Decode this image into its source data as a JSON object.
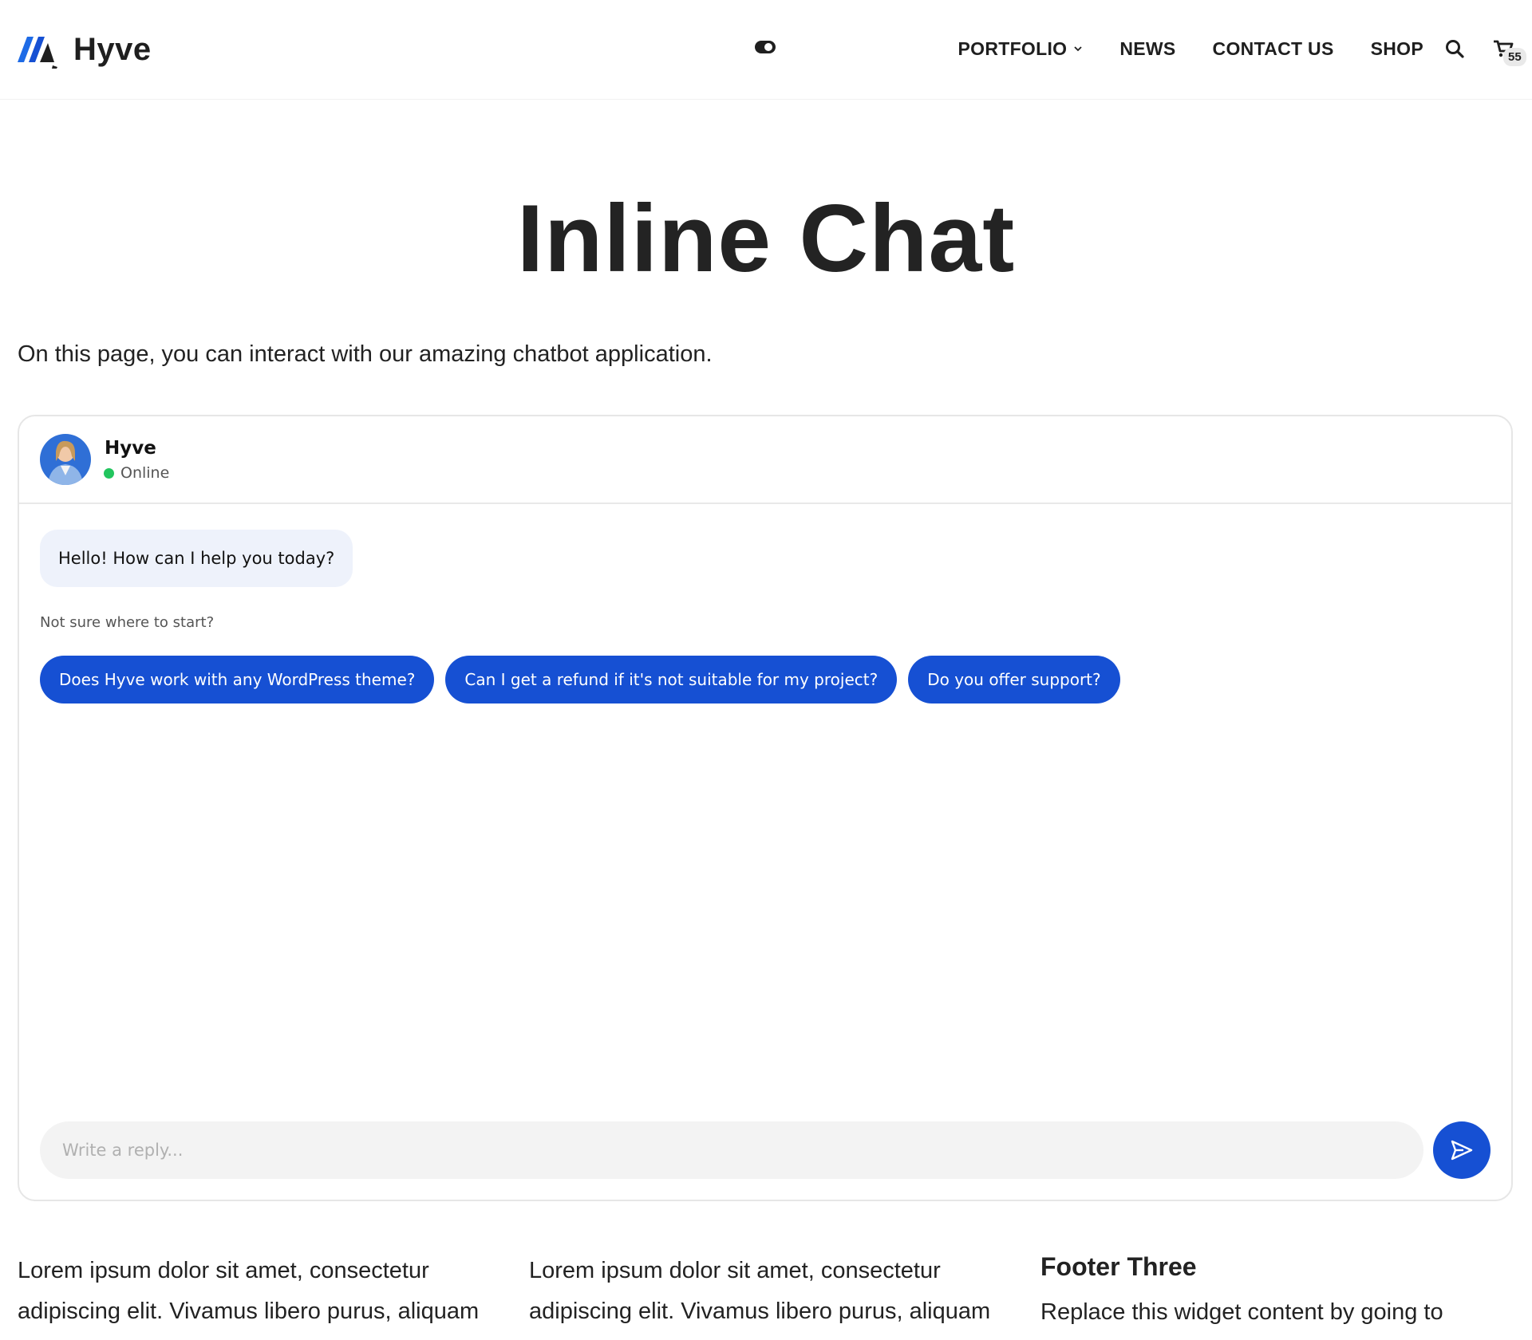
{
  "header": {
    "brand": "Hyve",
    "nav": [
      {
        "label": "PORTFOLIO"
      },
      {
        "label": "NEWS"
      },
      {
        "label": "CONTACT US"
      },
      {
        "label": "SHOP"
      }
    ],
    "cart_count": "55",
    "icons": {
      "logo": "hyve-logo-icon",
      "toggle": "theme-toggle-icon",
      "search": "search-icon",
      "cart": "cart-icon",
      "chevron": "chevron-down-icon"
    }
  },
  "main": {
    "title": "Inline Chat",
    "intro": "On this page, you can interact with our amazing chatbot application."
  },
  "chat": {
    "bot_name": "Hyve",
    "status": "Online",
    "greeting": "Hello! How can I help you today?",
    "hint": "Not sure where to start?",
    "suggestions": [
      "Does Hyve work with any WordPress theme?",
      "Can I get a refund if it's not suitable for my project?",
      "Do you offer support?"
    ],
    "reply_placeholder": "Write a reply...",
    "colors": {
      "accent": "#1650d3",
      "bubble": "#eef2fb",
      "online": "#22c55e"
    }
  },
  "footer": {
    "col1_line1": "Lorem ipsum dolor sit amet, consectetur",
    "col1_line2": "adipiscing elit. Vivamus libero purus, aliquam",
    "col2_line1": "Lorem ipsum dolor sit amet, consectetur",
    "col2_line2": "adipiscing elit. Vivamus libero purus, aliquam",
    "col3_title": "Footer Three",
    "col3_text": "Replace this widget content by going to"
  }
}
